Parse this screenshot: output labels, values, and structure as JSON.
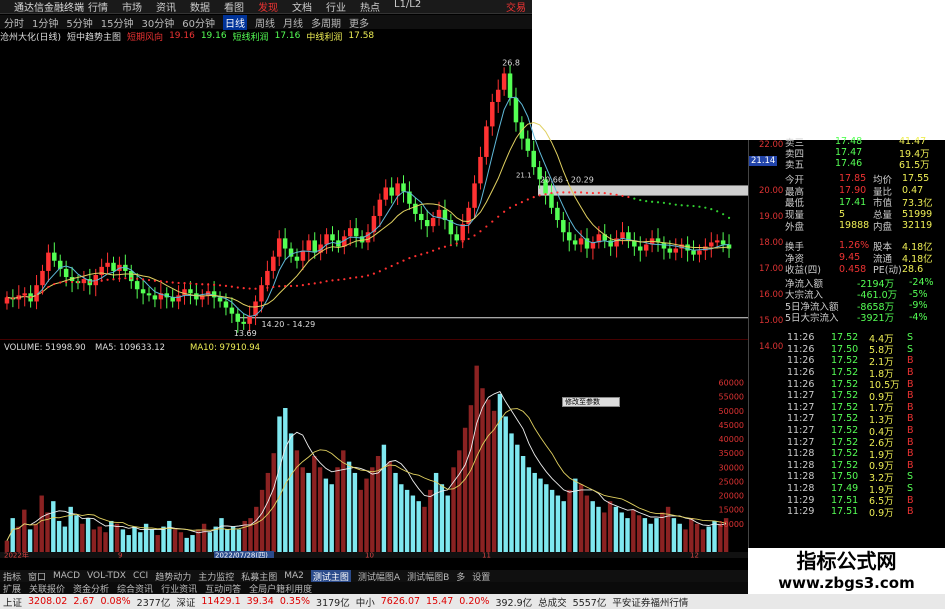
{
  "app": {
    "title": "通达信金融终端",
    "menu": [
      "行情",
      "市场",
      "资讯",
      "数据",
      "看图",
      "发现",
      "文档",
      "行业",
      "热点",
      "L1/L2"
    ],
    "logo": "交易"
  },
  "periods": [
    "分时",
    "1分钟",
    "5分钟",
    "15分钟",
    "30分钟",
    "60分钟",
    "日线",
    "周线",
    "月线",
    "多周期",
    "更多"
  ],
  "active_period": "日线",
  "infobar": {
    "stock": "沧州大化(日线)",
    "indicator": "短中趋势主图",
    "line1_label": "短期风向",
    "line1_value": "19.16",
    "line2_value": "19.16",
    "line3_label": "短线利润",
    "line3_value": "17.16",
    "line4_label": "中线利润",
    "line4_value": "17.58"
  },
  "colors": {
    "up": "#ff3232",
    "down": "#54ff54",
    "vol_up": "#8b2222",
    "vol_down": "#7fe8f0",
    "ma_dotted_red": "#ff3030",
    "ma_dotted_green": "#30d030",
    "yellow": "#e0d060",
    "cyan": "#5fb8d8",
    "white": "#ffffff"
  },
  "chart_data": [
    {
      "type": "candlestick",
      "price_axis_ticks": [
        "22.00",
        "20.00",
        "18.00",
        "16.00",
        "14.00"
      ],
      "ylim": [
        13.5,
        27.5
      ],
      "annotations": {
        "high_label": "26.8",
        "low_label": "13.69",
        "range_low": "14.20 - 14.29",
        "range_mid": "20.66 - 20.29",
        "mid_marker": "21.1"
      },
      "closes": [
        15.2,
        15.1,
        15.3,
        15.4,
        15.0,
        15.8,
        16.5,
        17.4,
        17.0,
        16.6,
        16.2,
        16.0,
        15.9,
        16.1,
        15.8,
        16.3,
        16.7,
        16.9,
        16.5,
        16.8,
        16.5,
        16.0,
        15.6,
        15.4,
        15.3,
        15.1,
        15.4,
        15.2,
        15.0,
        15.3,
        15.6,
        15.4,
        15.1,
        15.3,
        15.5,
        15.2,
        15.0,
        14.7,
        14.4,
        14.0,
        13.9,
        14.3,
        15.0,
        15.8,
        16.5,
        17.2,
        18.1,
        17.6,
        17.2,
        17.0,
        17.5,
        18.0,
        17.4,
        17.8,
        18.3,
        18.0,
        17.7,
        18.2,
        18.6,
        18.2,
        17.9,
        18.4,
        19.2,
        20.0,
        20.6,
        20.2,
        20.8,
        20.4,
        19.8,
        19.3,
        19.0,
        18.7,
        19.1,
        19.5,
        19.0,
        18.3,
        18.0,
        18.8,
        19.6,
        20.8,
        22.1,
        23.6,
        24.8,
        25.4,
        26.2,
        25.0,
        23.8,
        23.0,
        22.4,
        21.6,
        21.0,
        20.3,
        19.6,
        19.0,
        18.4,
        18.0,
        17.8,
        18.1,
        17.6,
        17.9,
        18.3,
        18.0,
        17.7,
        18.1,
        18.4,
        18.0,
        17.7,
        17.5,
        17.8,
        18.1,
        17.9,
        17.6,
        17.4,
        17.6,
        17.8,
        17.5,
        17.3,
        17.5,
        17.7,
        17.9,
        18.0,
        17.8,
        17.6
      ],
      "ma_line_yellow_start": 14.8,
      "ma_line_dotted_start": 15.3
    },
    {
      "type": "bar",
      "title": "VOLUME",
      "legend": {
        "volume_label": "VOLUME",
        "volume_value": "51998.90",
        "ma5_label": "MA5",
        "ma5_value": "109633.12",
        "ma10_label": "MA10",
        "ma10_value": "97910.94"
      },
      "axis_ticks": [
        "60000",
        "55000",
        "50000",
        "45000",
        "40000",
        "35000",
        "30000",
        "25000",
        "20000",
        "15000",
        "10000"
      ],
      "ylim": [
        0,
        68000
      ],
      "date_labels": [
        "2022年",
        "9",
        "2022/07/28(四)",
        "10",
        "11",
        "12"
      ],
      "values": [
        4000,
        12000,
        9000,
        15000,
        8000,
        10000,
        20000,
        14000,
        18000,
        11000,
        9000,
        16000,
        13000,
        10000,
        12000,
        8000,
        9000,
        7000,
        11000,
        10000,
        8000,
        6000,
        9000,
        7000,
        10000,
        8000,
        6000,
        9000,
        11000,
        8000,
        7000,
        5000,
        6000,
        8000,
        10000,
        7000,
        9000,
        12000,
        8000,
        9000,
        8000,
        11000,
        12000,
        16000,
        22000,
        28000,
        35000,
        48000,
        51000,
        42000,
        36000,
        30000,
        28000,
        34000,
        30000,
        26000,
        24000,
        30000,
        36000,
        32000,
        28000,
        22000,
        26000,
        30000,
        34000,
        38000,
        32000,
        28000,
        24000,
        22000,
        20000,
        18000,
        16000,
        22000,
        28000,
        24000,
        20000,
        30000,
        36000,
        44000,
        52000,
        66000,
        58000,
        54000,
        50000,
        56000,
        48000,
        42000,
        38000,
        34000,
        30000,
        28000,
        26000,
        24000,
        22000,
        20000,
        18000,
        22000,
        26000,
        24000,
        20000,
        18000,
        16000,
        14000,
        18000,
        16000,
        14000,
        12000,
        15000,
        13000,
        12000,
        10000,
        12000,
        14000,
        16000,
        12000,
        10000,
        8000,
        12000,
        10000,
        8000,
        9000,
        11000,
        10000,
        12000
      ]
    }
  ],
  "quote": {
    "ask_rows": [
      {
        "label": "卖三",
        "price": "17.48",
        "vol": "41.47"
      },
      {
        "label": "卖四",
        "price": "17.47",
        "vol": "19.4万"
      },
      {
        "label": "卖五",
        "price": "17.46",
        "vol": "61.5万"
      }
    ],
    "side_price_top": "22.00",
    "side_price_highlight": "21.14",
    "side_ticks": [
      "20.00",
      "19.00",
      "18.00",
      "17.00",
      "16.00",
      "15.00",
      "14.00"
    ],
    "fields": [
      {
        "l1": "今开",
        "v1": "17.85",
        "l2": "均价",
        "v2": "17.55"
      },
      {
        "l1": "最高",
        "v1": "17.90",
        "l2": "量比",
        "v2": "0.47"
      },
      {
        "l1": "最低",
        "v1": "17.41",
        "l2": "市值",
        "v2": "73.3亿"
      },
      {
        "l1": "现量",
        "v1": "5",
        "l2": "总量",
        "v2": "51999"
      },
      {
        "l1": "外盘",
        "v1": "19888",
        "l2": "内盘",
        "v2": "32119"
      },
      {
        "l1": "换手",
        "v1": "1.26%",
        "l2": "股本",
        "v2": "4.18亿"
      },
      {
        "l1": "净资",
        "v1": "9.45",
        "l2": "流通",
        "v2": "4.18亿"
      },
      {
        "l1": "收益(四)",
        "v1": "0.458",
        "l2": "PE(动)",
        "v2": "28.6"
      }
    ],
    "flows": [
      {
        "label": "净流入额",
        "value": "-2194万",
        "pct": "-24%"
      },
      {
        "label": "大宗流入",
        "value": "-461.0万",
        "pct": "-5%"
      },
      {
        "label": "5日净流入额",
        "value": "-8658万",
        "pct": "-9%"
      },
      {
        "label": "5日大宗流入",
        "value": "-3921万",
        "pct": "-4%"
      }
    ],
    "ticks": [
      {
        "t": "11:26",
        "p": "17.52",
        "v": "4.4万",
        "s": "S"
      },
      {
        "t": "11:26",
        "p": "17.50",
        "v": "5.8万",
        "s": "S"
      },
      {
        "t": "11:26",
        "p": "17.52",
        "v": "2.1万",
        "s": "B"
      },
      {
        "t": "11:26",
        "p": "17.52",
        "v": "1.8万",
        "s": "B"
      },
      {
        "t": "11:26",
        "p": "17.52",
        "v": "10.5万",
        "s": "B"
      },
      {
        "t": "11:27",
        "p": "17.52",
        "v": "0.9万",
        "s": "B"
      },
      {
        "t": "11:27",
        "p": "17.52",
        "v": "1.7万",
        "s": "B"
      },
      {
        "t": "11:27",
        "p": "17.52",
        "v": "1.3万",
        "s": "B"
      },
      {
        "t": "11:27",
        "p": "17.52",
        "v": "0.4万",
        "s": "B"
      },
      {
        "t": "11:27",
        "p": "17.52",
        "v": "2.6万",
        "s": "B"
      },
      {
        "t": "11:28",
        "p": "17.52",
        "v": "1.9万",
        "s": "B"
      },
      {
        "t": "11:28",
        "p": "17.52",
        "v": "0.9万",
        "s": "B"
      },
      {
        "t": "11:28",
        "p": "17.50",
        "v": "3.2万",
        "s": "S"
      },
      {
        "t": "11:28",
        "p": "17.49",
        "v": "1.9万",
        "s": "S"
      },
      {
        "t": "11:29",
        "p": "17.51",
        "v": "6.5万",
        "s": "B"
      },
      {
        "t": "11:29",
        "p": "17.51",
        "v": "0.9万",
        "s": "B"
      }
    ]
  },
  "tabs": [
    "指标",
    "窗口",
    "MACD",
    "VOL-TDX",
    "CCI",
    "趋势动力",
    "主力监控",
    "私募主图",
    "MA2",
    "测试主图",
    "测试幅图A",
    "测试幅图B",
    "多",
    "设置"
  ],
  "active_tab": "测试主图",
  "subtabs": [
    "扩展",
    "关联报价",
    "资金分析",
    "综合资讯",
    "行业资讯",
    "互动问答",
    "全局户籍利用度"
  ],
  "status": [
    {
      "label": "上证",
      "value": "3208.02",
      "chg": "2.67",
      "pct": "0.08%",
      "amt": "2377亿"
    },
    {
      "label": "深证",
      "value": "11429.1",
      "chg": "39.34",
      "pct": "0.35%",
      "amt": "3179亿"
    },
    {
      "label": "中小",
      "value": "7626.07",
      "chg": "15.47",
      "pct": "0.20%",
      "amt": "392.9亿"
    }
  ],
  "status_extra": {
    "label": "总成交",
    "value": "5557亿",
    "broker": "平安证券福州行情"
  },
  "watermark": {
    "line1": "指标公式网",
    "line2": "www.zbgs3.com"
  },
  "tooltip": "修改至参数"
}
